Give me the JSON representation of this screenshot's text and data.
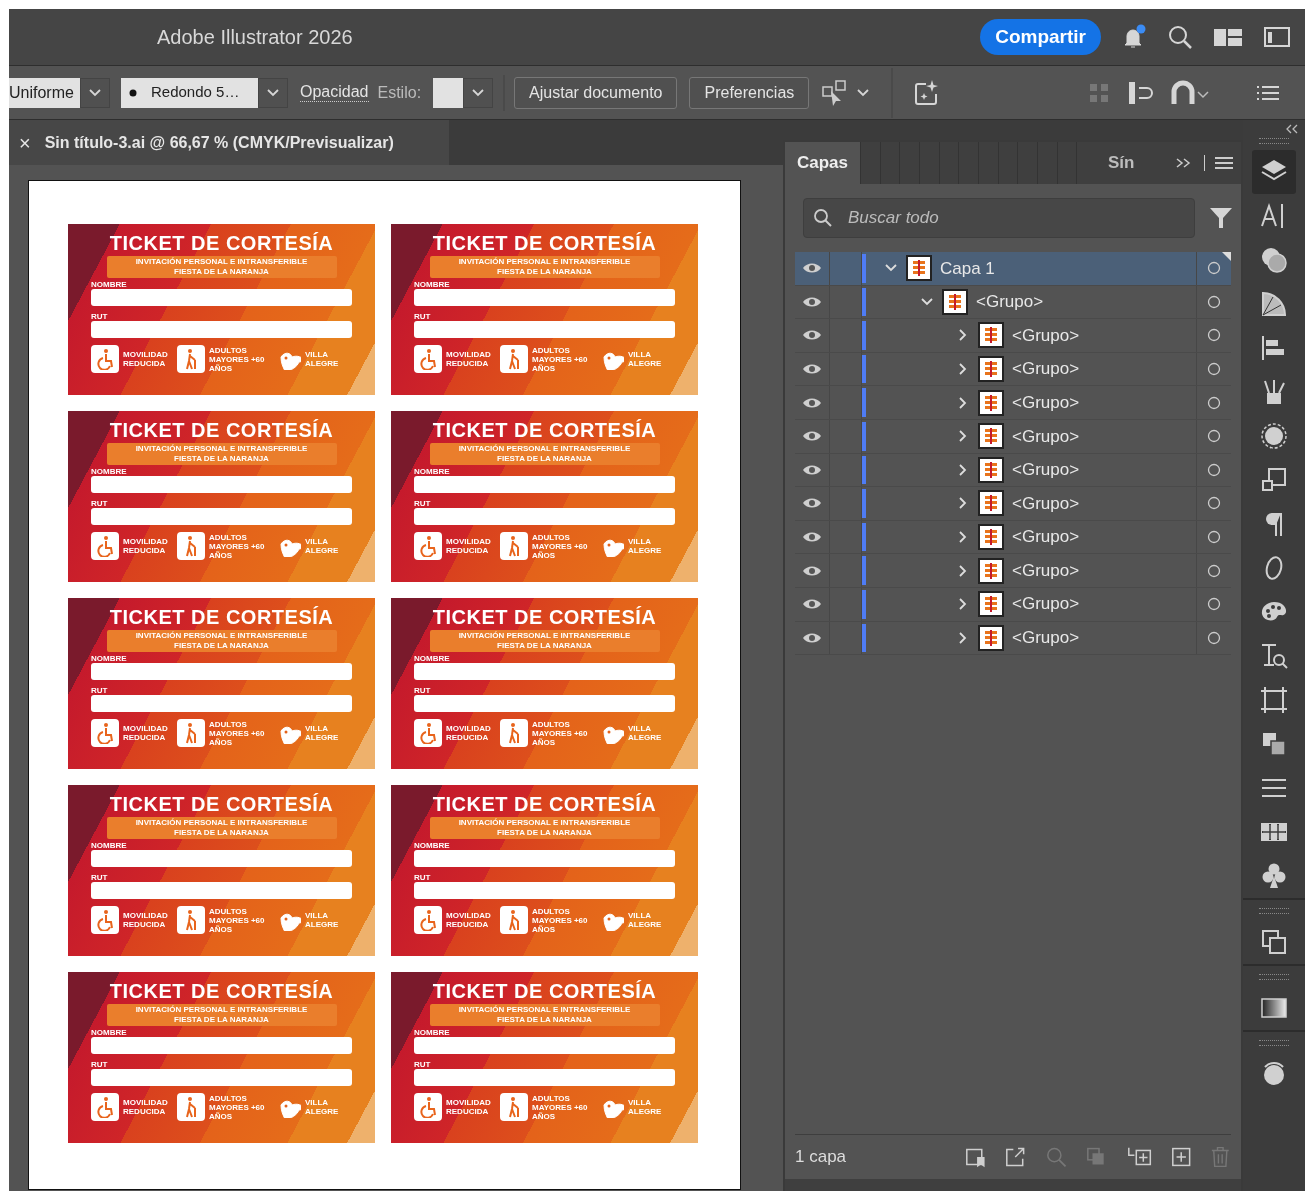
{
  "window": {
    "title": "Adobe Illustrator 2026",
    "share_button": "Compartir"
  },
  "control_bar": {
    "profile": "Uniforme",
    "brush": "Redondo 5…",
    "opacity_link": "Opacidad",
    "style_label": "Estilo:",
    "buttons": [
      "Ajustar documento",
      "Preferencias"
    ]
  },
  "document_tab": {
    "close": "×",
    "title": "Sin título-3.ai @ 66,67 % (CMYK/Previsualizar)"
  },
  "tickets": [
    {
      "title": "TICKET DE CORTESÍA",
      "subtitle": "INVITACIÓN PERSONAL E INTRANSFERIBLE",
      "event": "FIESTA DE LA NARANJA",
      "name_label": "NOMBRE",
      "id_label": "RUT",
      "badges": [
        {
          "kind": "wheelchair",
          "text": "MOVILIDAD REDUCIDA"
        },
        {
          "kind": "elderly",
          "text": "ADULTOS MAYORES +60 AÑOS"
        }
      ],
      "logo": "VILLA ALEGRE"
    },
    {
      "title": "TICKET DE CORTESÍA",
      "subtitle": "INVITACIÓN PERSONAL E INTRANSFERIBLE",
      "event": "FIESTA DE LA NARANJA",
      "name_label": "NOMBRE",
      "id_label": "RUT",
      "badges": [
        {
          "kind": "wheelchair",
          "text": "MOVILIDAD REDUCIDA"
        },
        {
          "kind": "elderly",
          "text": "ADULTOS MAYORES +60 AÑOS"
        }
      ],
      "logo": "VILLA ALEGRE"
    },
    {
      "title": "TICKET DE CORTESÍA",
      "subtitle": "INVITACIÓN PERSONAL E INTRANSFERIBLE",
      "event": "FIESTA DE LA NARANJA",
      "name_label": "NOMBRE",
      "id_label": "RUT",
      "badges": [
        {
          "kind": "wheelchair",
          "text": "MOVILIDAD REDUCIDA"
        },
        {
          "kind": "elderly",
          "text": "ADULTOS MAYORES +60 AÑOS"
        }
      ],
      "logo": "VILLA ALEGRE"
    },
    {
      "title": "TICKET DE CORTESÍA",
      "subtitle": "INVITACIÓN PERSONAL E INTRANSFERIBLE",
      "event": "FIESTA DE LA NARANJA",
      "name_label": "NOMBRE",
      "id_label": "RUT",
      "badges": [
        {
          "kind": "wheelchair",
          "text": "MOVILIDAD REDUCIDA"
        },
        {
          "kind": "elderly",
          "text": "ADULTOS MAYORES +60 AÑOS"
        }
      ],
      "logo": "VILLA ALEGRE"
    },
    {
      "title": "TICKET DE CORTESÍA",
      "subtitle": "INVITACIÓN PERSONAL E INTRANSFERIBLE",
      "event": "FIESTA DE LA NARANJA",
      "name_label": "NOMBRE",
      "id_label": "RUT",
      "badges": [
        {
          "kind": "wheelchair",
          "text": "MOVILIDAD REDUCIDA"
        },
        {
          "kind": "elderly",
          "text": "ADULTOS MAYORES +60 AÑOS"
        }
      ],
      "logo": "VILLA ALEGRE"
    },
    {
      "title": "TICKET DE CORTESÍA",
      "subtitle": "INVITACIÓN PERSONAL E INTRANSFERIBLE",
      "event": "FIESTA DE LA NARANJA",
      "name_label": "NOMBRE",
      "id_label": "RUT",
      "badges": [
        {
          "kind": "wheelchair",
          "text": "MOVILIDAD REDUCIDA"
        },
        {
          "kind": "elderly",
          "text": "ADULTOS MAYORES +60 AÑOS"
        }
      ],
      "logo": "VILLA ALEGRE"
    },
    {
      "title": "TICKET DE CORTESÍA",
      "subtitle": "INVITACIÓN PERSONAL E INTRANSFERIBLE",
      "event": "FIESTA DE LA NARANJA",
      "name_label": "NOMBRE",
      "id_label": "RUT",
      "badges": [
        {
          "kind": "wheelchair",
          "text": "MOVILIDAD REDUCIDA"
        },
        {
          "kind": "elderly",
          "text": "ADULTOS MAYORES +60 AÑOS"
        }
      ],
      "logo": "VILLA ALEGRE"
    },
    {
      "title": "TICKET DE CORTESÍA",
      "subtitle": "INVITACIÓN PERSONAL E INTRANSFERIBLE",
      "event": "FIESTA DE LA NARANJA",
      "name_label": "NOMBRE",
      "id_label": "RUT",
      "badges": [
        {
          "kind": "wheelchair",
          "text": "MOVILIDAD REDUCIDA"
        },
        {
          "kind": "elderly",
          "text": "ADULTOS MAYORES +60 AÑOS"
        }
      ],
      "logo": "VILLA ALEGRE"
    },
    {
      "title": "TICKET DE CORTESÍA",
      "subtitle": "INVITACIÓN PERSONAL E INTRANSFERIBLE",
      "event": "FIESTA DE LA NARANJA",
      "name_label": "NOMBRE",
      "id_label": "RUT",
      "badges": [
        {
          "kind": "wheelchair",
          "text": "MOVILIDAD REDUCIDA"
        },
        {
          "kind": "elderly",
          "text": "ADULTOS MAYORES +60 AÑOS"
        }
      ],
      "logo": "VILLA ALEGRE"
    },
    {
      "title": "TICKET DE CORTESÍA",
      "subtitle": "INVITACIÓN PERSONAL E INTRANSFERIBLE",
      "event": "FIESTA DE LA NARANJA",
      "name_label": "NOMBRE",
      "id_label": "RUT",
      "badges": [
        {
          "kind": "wheelchair",
          "text": "MOVILIDAD REDUCIDA"
        },
        {
          "kind": "elderly",
          "text": "ADULTOS MAYORES +60 AÑOS"
        }
      ],
      "logo": "VILLA ALEGRE"
    }
  ],
  "layers_panel": {
    "tabs": [
      {
        "label": "Capas",
        "selected": true
      },
      {
        "label": "Sín",
        "selected": false
      }
    ],
    "search": {
      "placeholder": "Buscar todo"
    },
    "layers": [
      {
        "name": "Capa 1",
        "visible": true,
        "expanded": true,
        "selected": true,
        "children": [
          {
            "name": "<Grupo>",
            "visible": true,
            "expanded": true,
            "selected": false,
            "children": [
              {
                "name": "<Grupo>",
                "visible": true,
                "expanded": false,
                "selected": false
              },
              {
                "name": "<Grupo>",
                "visible": true,
                "expanded": false,
                "selected": false
              },
              {
                "name": "<Grupo>",
                "visible": true,
                "expanded": false,
                "selected": false
              },
              {
                "name": "<Grupo>",
                "visible": true,
                "expanded": false,
                "selected": false
              },
              {
                "name": "<Grupo>",
                "visible": true,
                "expanded": false,
                "selected": false
              },
              {
                "name": "<Grupo>",
                "visible": true,
                "expanded": false,
                "selected": false
              },
              {
                "name": "<Grupo>",
                "visible": true,
                "expanded": false,
                "selected": false
              },
              {
                "name": "<Grupo>",
                "visible": true,
                "expanded": false,
                "selected": false
              },
              {
                "name": "<Grupo>",
                "visible": true,
                "expanded": false,
                "selected": false
              },
              {
                "name": "<Grupo>",
                "visible": true,
                "expanded": false,
                "selected": false
              }
            ]
          }
        ]
      }
    ],
    "footer": "1 capa"
  }
}
